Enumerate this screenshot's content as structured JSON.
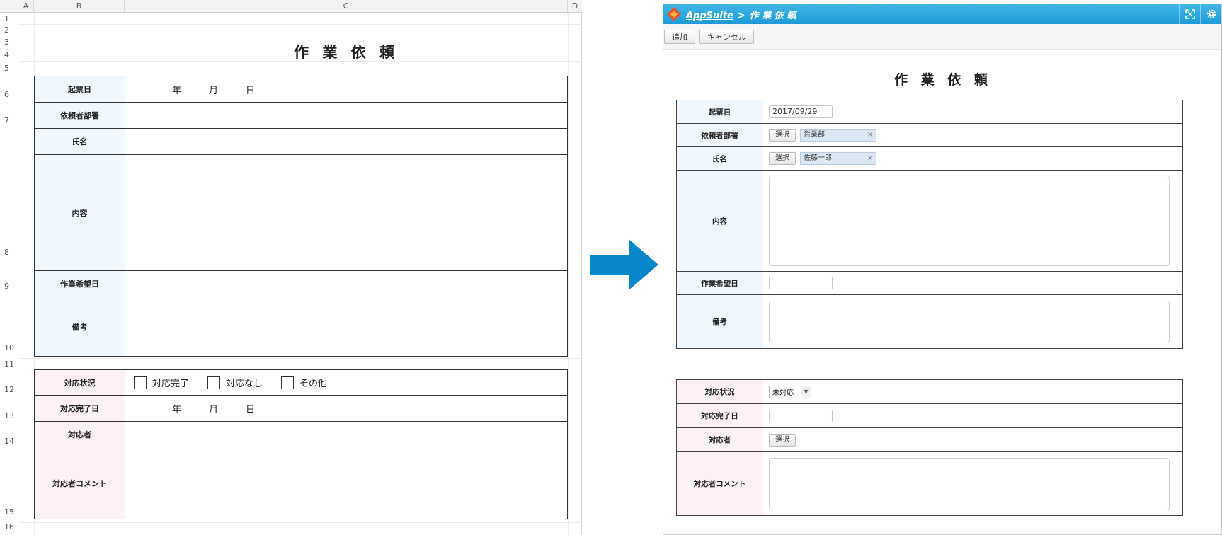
{
  "excel": {
    "columns": [
      "A",
      "B",
      "C",
      "D"
    ],
    "rows": [
      "1",
      "2",
      "3",
      "4",
      "5",
      "6",
      "7",
      "8",
      "9",
      "10",
      "11",
      "12",
      "13",
      "14",
      "15",
      "16"
    ],
    "title": "作 業 依 頼",
    "fields": {
      "date_label": "起票日",
      "dept_label": "依頼者部署",
      "name_label": "氏名",
      "content_label": "内容",
      "wish_date_label": "作業希望日",
      "notes_label": "備考",
      "status_label": "対応状況",
      "done_date_label": "対応完了日",
      "handler_label": "対応者",
      "comment_label": "対応者コメント"
    },
    "date_parts": {
      "year": "年",
      "month": "月",
      "day": "日"
    },
    "status_options": [
      "対応完了",
      "対応なし",
      "その他"
    ]
  },
  "app": {
    "breadcrumb": {
      "app": "AppSuite",
      "separator": ">",
      "page": "作 業 依 頼"
    },
    "toolbar": {
      "add": "追加",
      "cancel": "キャンセル"
    },
    "title": "作 業 依 頼",
    "fields": {
      "date_label": "起票日",
      "date_value": "2017/09/29",
      "dept_label": "依頼者部署",
      "dept_select": "選択",
      "dept_value": "営業部",
      "name_label": "氏名",
      "name_select": "選択",
      "name_value": "佐藤一郎",
      "content_label": "内容",
      "wish_date_label": "作業希望日",
      "notes_label": "備考",
      "status_label": "対応状況",
      "status_value": "未対応",
      "done_date_label": "対応完了日",
      "handler_label": "対応者",
      "handler_select": "選択",
      "comment_label": "対応者コメント"
    },
    "chip_remove": "×"
  },
  "icons": {
    "arrow": "right-arrow-icon",
    "logo": "appsuite-logo-icon",
    "fullscreen": "fullscreen-icon",
    "settings": "gear-icon"
  },
  "colors": {
    "header": "#1f9ad6",
    "arrow": "#0a86cc",
    "label_blue": "#f0f7fd",
    "label_pink": "#fdf1f4"
  }
}
